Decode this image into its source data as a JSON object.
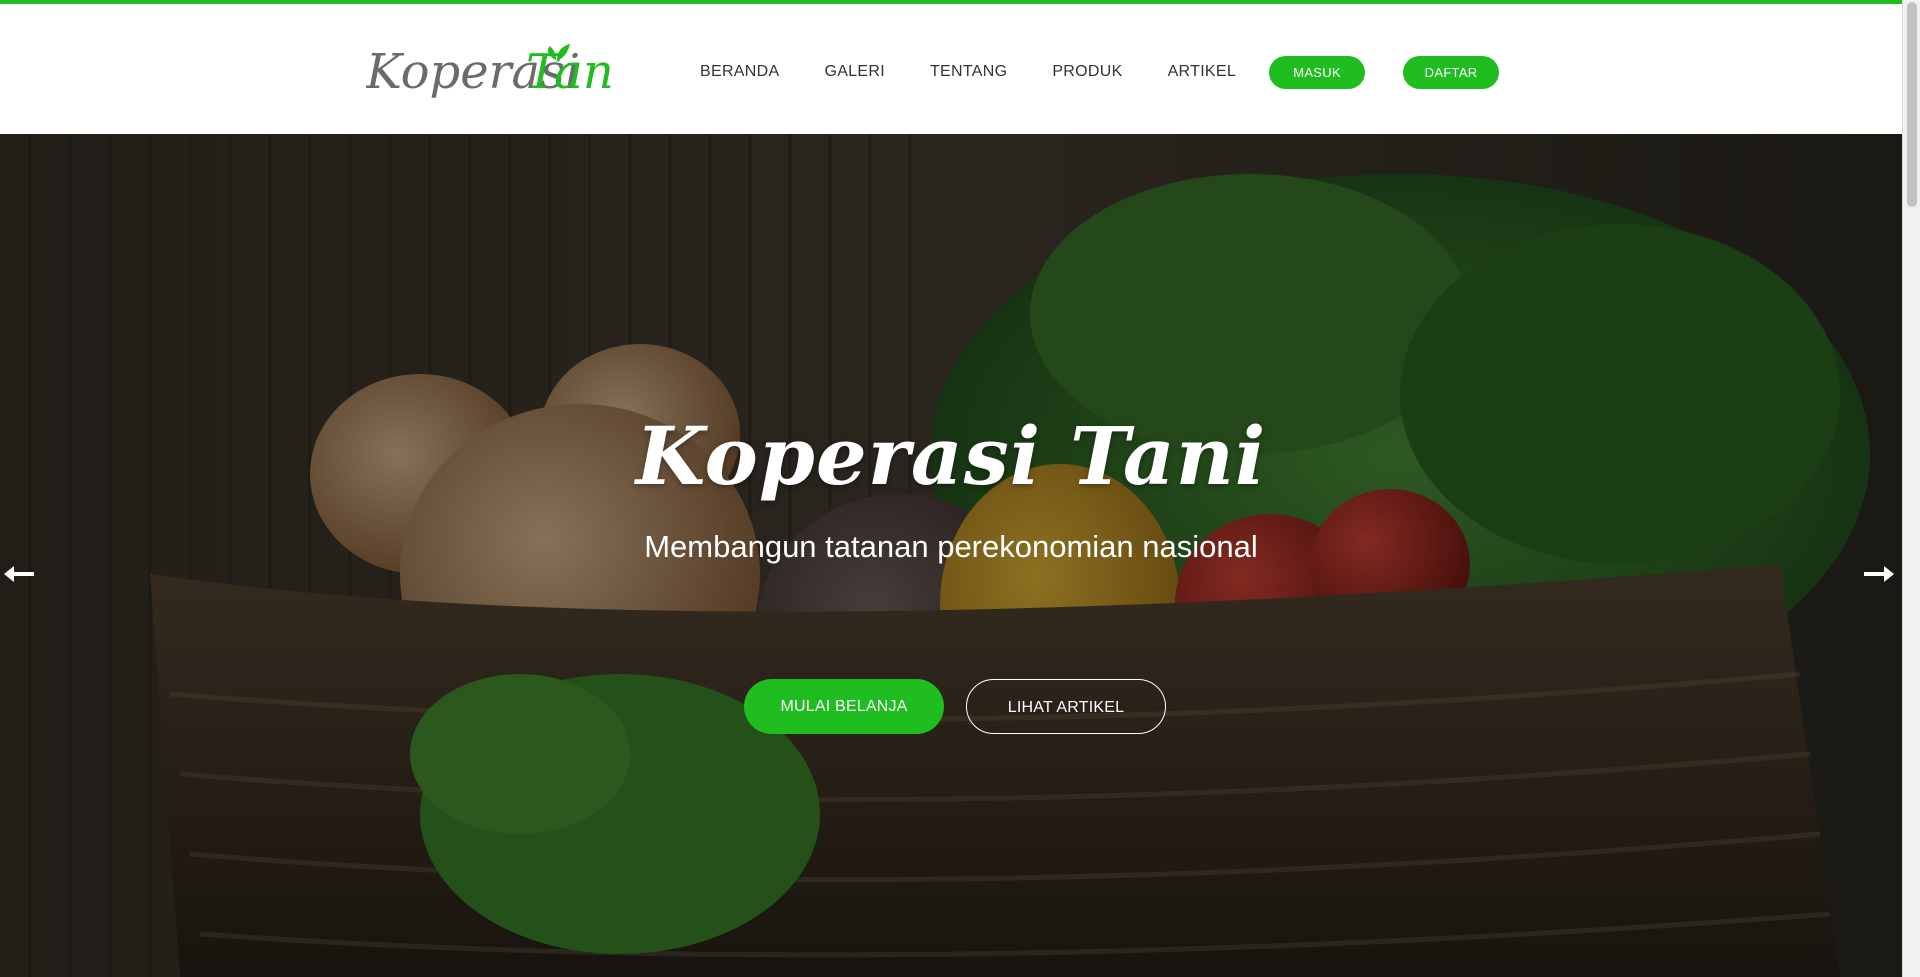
{
  "header": {
    "logo": {
      "text_part1": "Koperasi",
      "text_part2": "Tani",
      "icon": "leaf-icon"
    },
    "nav": [
      {
        "label": "BERANDA"
      },
      {
        "label": "GALERI"
      },
      {
        "label": "TENTANG"
      },
      {
        "label": "PRODUK"
      },
      {
        "label": "ARTIKEL"
      }
    ],
    "login_label": "MASUK",
    "register_label": "DAFTAR"
  },
  "hero": {
    "title": "Koperasi Tani",
    "subtitle": "Membangun tatanan perekonomian nasional",
    "primary_cta": "MULAI BELANJA",
    "secondary_cta": "LIHAT ARTIKEL",
    "prev_icon": "arrow-left-icon",
    "next_icon": "arrow-right-icon"
  },
  "colors": {
    "accent": "#1fbd1f",
    "logo_grey": "#6b6b6b",
    "nav_text": "#333333"
  }
}
